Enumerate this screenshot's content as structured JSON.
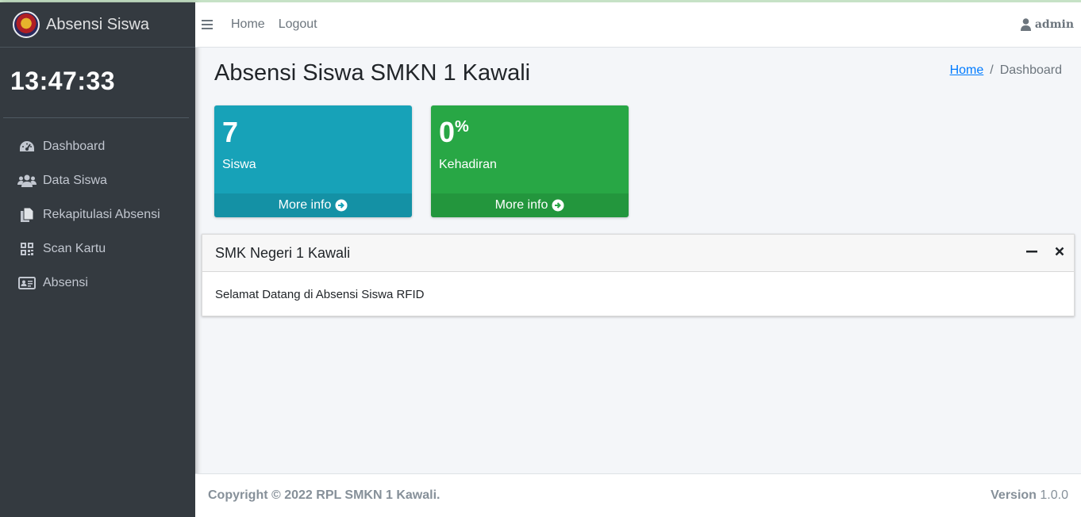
{
  "brand": {
    "title": "Absensi Siswa"
  },
  "clock": "13:47:33",
  "sidebar": {
    "items": [
      {
        "label": "Dashboard",
        "icon": "tachometer-icon"
      },
      {
        "label": "Data Siswa",
        "icon": "users-icon"
      },
      {
        "label": "Rekapitulasi Absensi",
        "icon": "copy-icon"
      },
      {
        "label": "Scan Kartu",
        "icon": "qrcode-icon"
      },
      {
        "label": "Absensi",
        "icon": "id-card-icon"
      }
    ]
  },
  "header": {
    "links": [
      "Home",
      "Logout"
    ],
    "user": "admin"
  },
  "page": {
    "title": "Absensi Siswa SMKN 1 Kawali",
    "breadcrumb": {
      "home": "Home",
      "separator": "/",
      "current": "Dashboard"
    }
  },
  "stats": [
    {
      "value": "7",
      "suffix": "",
      "label": "Siswa",
      "footer": "More info",
      "color": "#17a2b8"
    },
    {
      "value": "0",
      "suffix": "%",
      "label": "Kehadiran",
      "footer": "More info",
      "color": "#28a745"
    }
  ],
  "card": {
    "title": "SMK Negeri 1 Kawali",
    "body": "Selamat Datang di Absensi Siswa RFID"
  },
  "footer": {
    "copyright": "Copyright © 2022 RPL SMKN 1 Kawali.",
    "version_label": "Version",
    "version": "1.0.0"
  }
}
